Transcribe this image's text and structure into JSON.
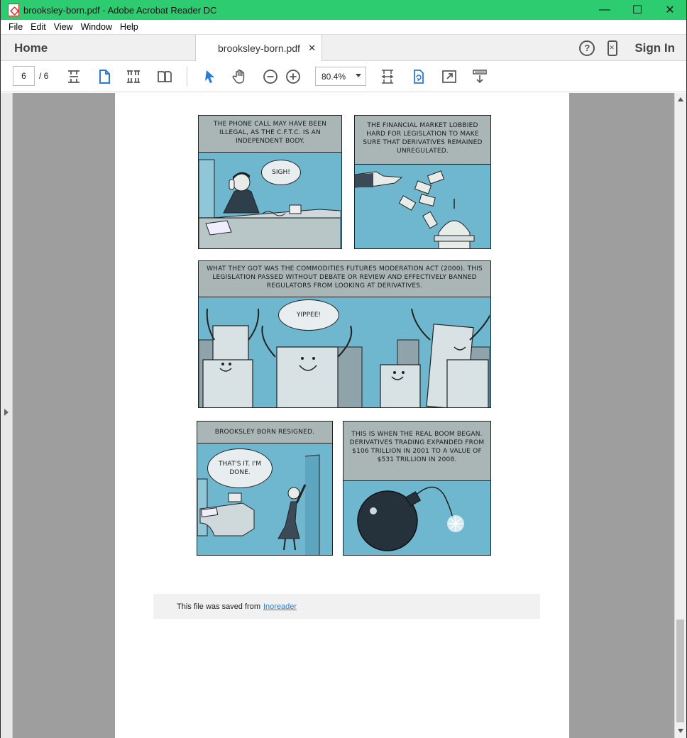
{
  "window": {
    "title": "brooksley-born.pdf - Adobe Acrobat Reader DC",
    "minimize": "—",
    "maximize": "☐",
    "close": "✕"
  },
  "menu": {
    "items": [
      {
        "label": "File"
      },
      {
        "label": "Edit"
      },
      {
        "label": "View"
      },
      {
        "label": "Window"
      },
      {
        "label": "Help"
      }
    ]
  },
  "tabs": {
    "home": "Home",
    "document": "brooksley-born.pdf",
    "close": "✕",
    "help": "?",
    "signin": "Sign In"
  },
  "toolbar": {
    "page_current": "6",
    "page_total": "/ 6",
    "zoom": "80.4%"
  },
  "comic": {
    "panel1_caption": "The phone call may have been illegal, as the C.F.T.C. is an independent body.",
    "panel1_bubble": "Sigh!",
    "panel2_caption": "The financial market lobbied hard for legislation to make sure that derivatives remained unregulated.",
    "panel3_caption": "What they got was the Commodities Futures Moderation Act (2000). This legislation passed without debate or review and effectively banned regulators from looking at derivatives.",
    "panel3_bubble": "Yippee!",
    "panel4_caption": "Brooksley Born resigned.",
    "panel4_bubble": "That's it. I'm done.",
    "panel5_caption": "This is when the real boom began. Derivatives trading expanded from $106 trillion in 2001 to a value of $531 trillion in 2008."
  },
  "footer": {
    "text": "This file was saved from",
    "link": "Inoreader"
  },
  "colors": {
    "titlebar": "#2ecc71",
    "panel_blue": "#6fb7cf",
    "caption_gray": "#aab6b6",
    "link": "#2a7ed8"
  }
}
